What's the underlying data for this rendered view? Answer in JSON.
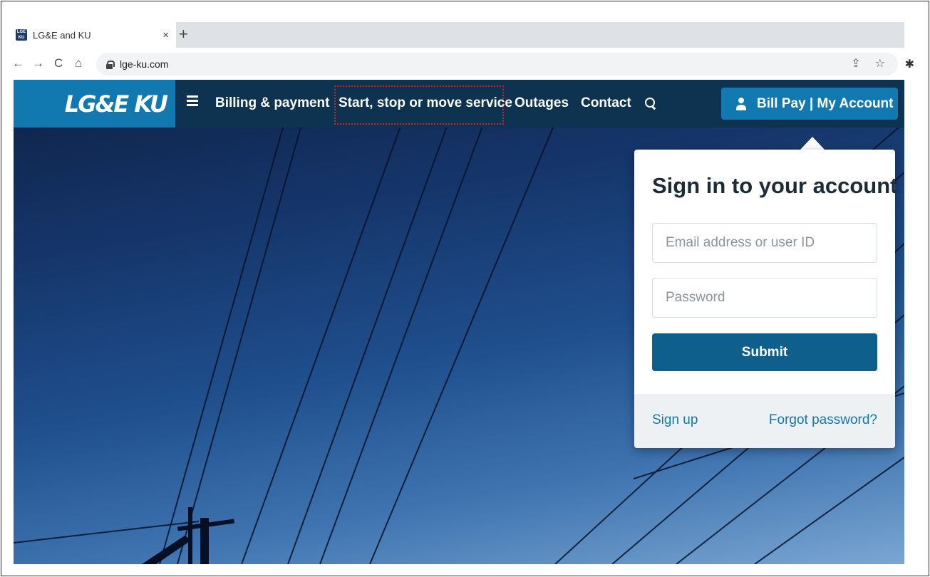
{
  "browser": {
    "tab_title": "LG&E and KU",
    "favicon_text": "LGE KU",
    "tab_close": "×",
    "new_tab": "+",
    "back": "←",
    "forward": "→",
    "reload": "C",
    "home": "⌂",
    "url": "lge-ku.com",
    "share_icon": "⇪",
    "star_icon": "☆",
    "extension_icon": "✱"
  },
  "header": {
    "logo": "LG&E KU",
    "nav": [
      {
        "label": "Billing & payment"
      },
      {
        "label": "Start, stop or move service"
      },
      {
        "label": "Outages"
      },
      {
        "label": "Contact"
      }
    ],
    "account_button": "Bill Pay | My Account"
  },
  "signin": {
    "title": "Sign in to your account",
    "email_placeholder": "Email address or user ID",
    "password_placeholder": "Password",
    "submit": "Submit",
    "signup": "Sign up",
    "forgot": "Forgot password?"
  },
  "colors": {
    "brand_blue": "#1178b0",
    "header_dark": "#0d3350",
    "submit_blue": "#0f5f8d",
    "highlight_red": "#d61c1c"
  }
}
